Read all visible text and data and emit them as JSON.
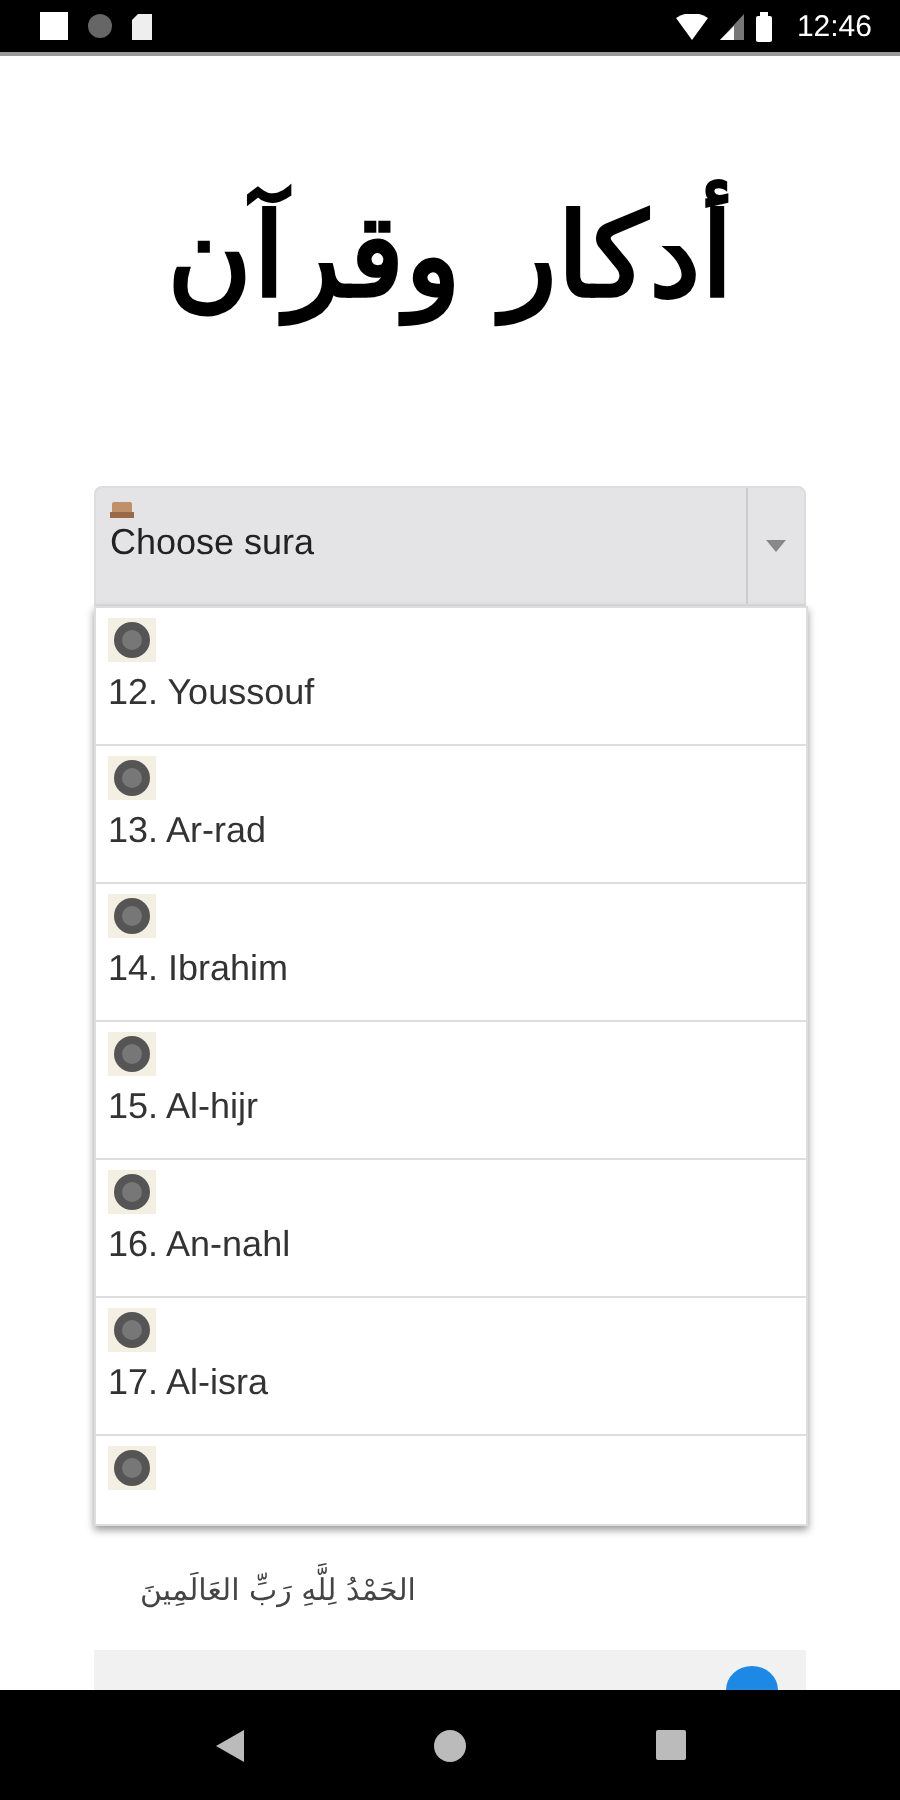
{
  "status_bar": {
    "time": "12:46"
  },
  "title": "أدكار وقرآن",
  "select": {
    "placeholder": "Choose sura",
    "expanded": true
  },
  "options": [
    {
      "label": "12. Youssouf"
    },
    {
      "label": "13. Ar-rad"
    },
    {
      "label": "14. Ibrahim"
    },
    {
      "label": "15. Al-hijr"
    },
    {
      "label": "16. An-nahl"
    },
    {
      "label": "17. Al-isra"
    }
  ],
  "verse": "الحَمْدُ لِلَّهِ رَبِّ العَالَمِينَ"
}
